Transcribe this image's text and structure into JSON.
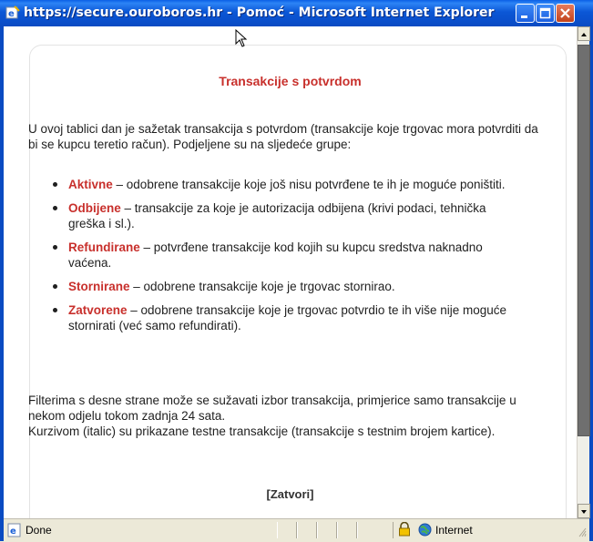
{
  "window": {
    "title": "https://secure.ouroboros.hr - Pomoć - Microsoft Internet Explorer"
  },
  "page": {
    "heading": "Transakcije s potvrdom",
    "intro": "U ovoj tablici dan je sažetak transakcija s potvrdom (transakcije koje trgovac mora potvrditi da bi se kupcu teretio račun). Podjeljene su na sljedeće grupe:",
    "groups": [
      {
        "term": "Aktivne",
        "desc": " – odobrene transakcije koje još nisu potvrđene te ih je moguće poništiti."
      },
      {
        "term": "Odbijene",
        "desc": " – transakcije za koje je autorizacija odbijena (krivi podaci, tehnička greška i sl.)."
      },
      {
        "term": "Refundirane",
        "desc": " – potvrđene transakcije kod kojih su kupcu sredstva naknadno vaćena."
      },
      {
        "term": "Stornirane",
        "desc": " – odobrene transakcije koje je trgovac stornirao."
      },
      {
        "term": "Zatvorene",
        "desc": " – odobrene transakcije koje je trgovac potvrdio te ih više nije moguće stornirati (već samo refundirati)."
      }
    ],
    "outro_1": "Filterima s desne strane može se sužavati izbor transakcija, primjerice samo transakcije u nekom odjelu tokom zadnja 24 sata.",
    "outro_2": "Kurzivom (italic) su prikazane testne transakcije (transakcije s testnim brojem kartice).",
    "close_link": "[Zatvori]"
  },
  "statusbar": {
    "status": "Done",
    "zone": "Internet",
    "icons": [
      "ie-page-icon",
      "lock-icon",
      "internet-globe-icon"
    ]
  },
  "colors": {
    "accent": "#C8302C",
    "titlebar": "#0A4FCB"
  }
}
